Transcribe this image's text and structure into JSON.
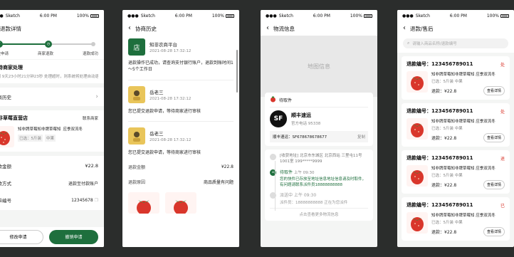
{
  "colors": {
    "accent": "#1e6f3d",
    "red": "#d9362b"
  },
  "status_bar": {
    "carrier": "Sketch",
    "time": "6:00 PM",
    "battery": "100%"
  },
  "s1": {
    "title": "退款详情",
    "steps": [
      "提交申请",
      "商家退款",
      "退款成功"
    ],
    "status_title": "等待商家处理",
    "status_desc": "还剩 9天23小时21分钟23秒 处理超时，则系统将处理自动退款",
    "history_label": "协商历史",
    "store_name": "知非草莓直营店",
    "contact_label": "联系商家",
    "product_name": "知非牌草莓知非牌草莓知",
    "product_badge": "应季双流冬",
    "product_tag1": "已选：5斤装",
    "product_tag2": "中果",
    "amount_label": "退款金额",
    "amount_value": "¥22.8",
    "method_label": "退款方式",
    "method_value": "退款至付款账户",
    "order_label": "订单编号",
    "order_value": "12345678",
    "btn_modify": "修改申请",
    "btn_cancel": "撤销申请"
  },
  "s2": {
    "title": "协商历史",
    "entries": [
      {
        "name": "知非农商平台",
        "time": "2021-08-28 17:32:12",
        "text": "退款操作已成功，请查询支付银行账户，退款到账时间1～5个工作日",
        "avatar": "店"
      },
      {
        "name": "岳老三",
        "time": "2021-08-28 17:32:12",
        "text": "您已提交退款申请，等待商家进行审核"
      },
      {
        "name": "岳老三",
        "time": "2021-08-28 17:32:12",
        "text": "您已提交退款申请，等待商家进行审核"
      }
    ],
    "amount_label": "退款金额",
    "amount_value": "¥22.8",
    "reason_label": "退款原因",
    "reason_value": "商品质量有问题"
  },
  "s3": {
    "title": "物流信息",
    "map_label": "地图信息",
    "status": "待取件",
    "courier_name": "顺丰速运",
    "courier_phone": "官方电话 95338",
    "courier_logo": "SF",
    "tracking_label": "顺丰速运：SF678678678677",
    "copy_label": "复制",
    "address_tag": "[收获地址]",
    "address": "北京市东城区 北京西站 三里屯11号1001室 199*****9999",
    "ev1_title": "待取件",
    "ev1_time": "上午 09:30",
    "ev1_text": "您的快件已存放至地址信息地址信息请及时取件，有问题请联系派件员18888888888",
    "ev2_title": "派送中",
    "ev2_time": "上午 09:30",
    "ev2_text": "派件员：18888888888 正在为您派件",
    "more": "点击查看更多物流信息"
  },
  "s4": {
    "title": "退款/售后",
    "search_placeholder": "请输入商品名称/退款编号",
    "refund_prefix": "退款编号：",
    "items": [
      {
        "no": "123456789011",
        "status": "处",
        "name": "知非牌草莓知非牌草莓知",
        "badge": "应季双流冬",
        "tag": "已选：5斤装 中果",
        "amount_label": "退款：",
        "amount": "¥22.8",
        "btn": "查看详情"
      },
      {
        "no": "123456789011",
        "status": "处",
        "name": "知非牌草莓知非牌草莓知",
        "badge": "应季双流冬",
        "tag": "已选：5斤装 中果",
        "amount_label": "退款：",
        "amount": "¥22.8",
        "btn": "查看详情"
      },
      {
        "no": "123456789011",
        "status": "退",
        "name": "知非牌草莓知非牌草莓知",
        "badge": "应季双流冬",
        "tag": "已选：5斤装 中果",
        "amount_label": "退款：",
        "amount": "¥22.8",
        "btn": "查看详情"
      },
      {
        "no": "123456789011",
        "status": "已",
        "name": "知非牌草莓知非牌草莓知",
        "badge": "应季双流冬",
        "tag": "已选：5斤装 中果",
        "amount_label": "退款：",
        "amount": "¥22.8",
        "btn": "查看详情"
      }
    ]
  }
}
